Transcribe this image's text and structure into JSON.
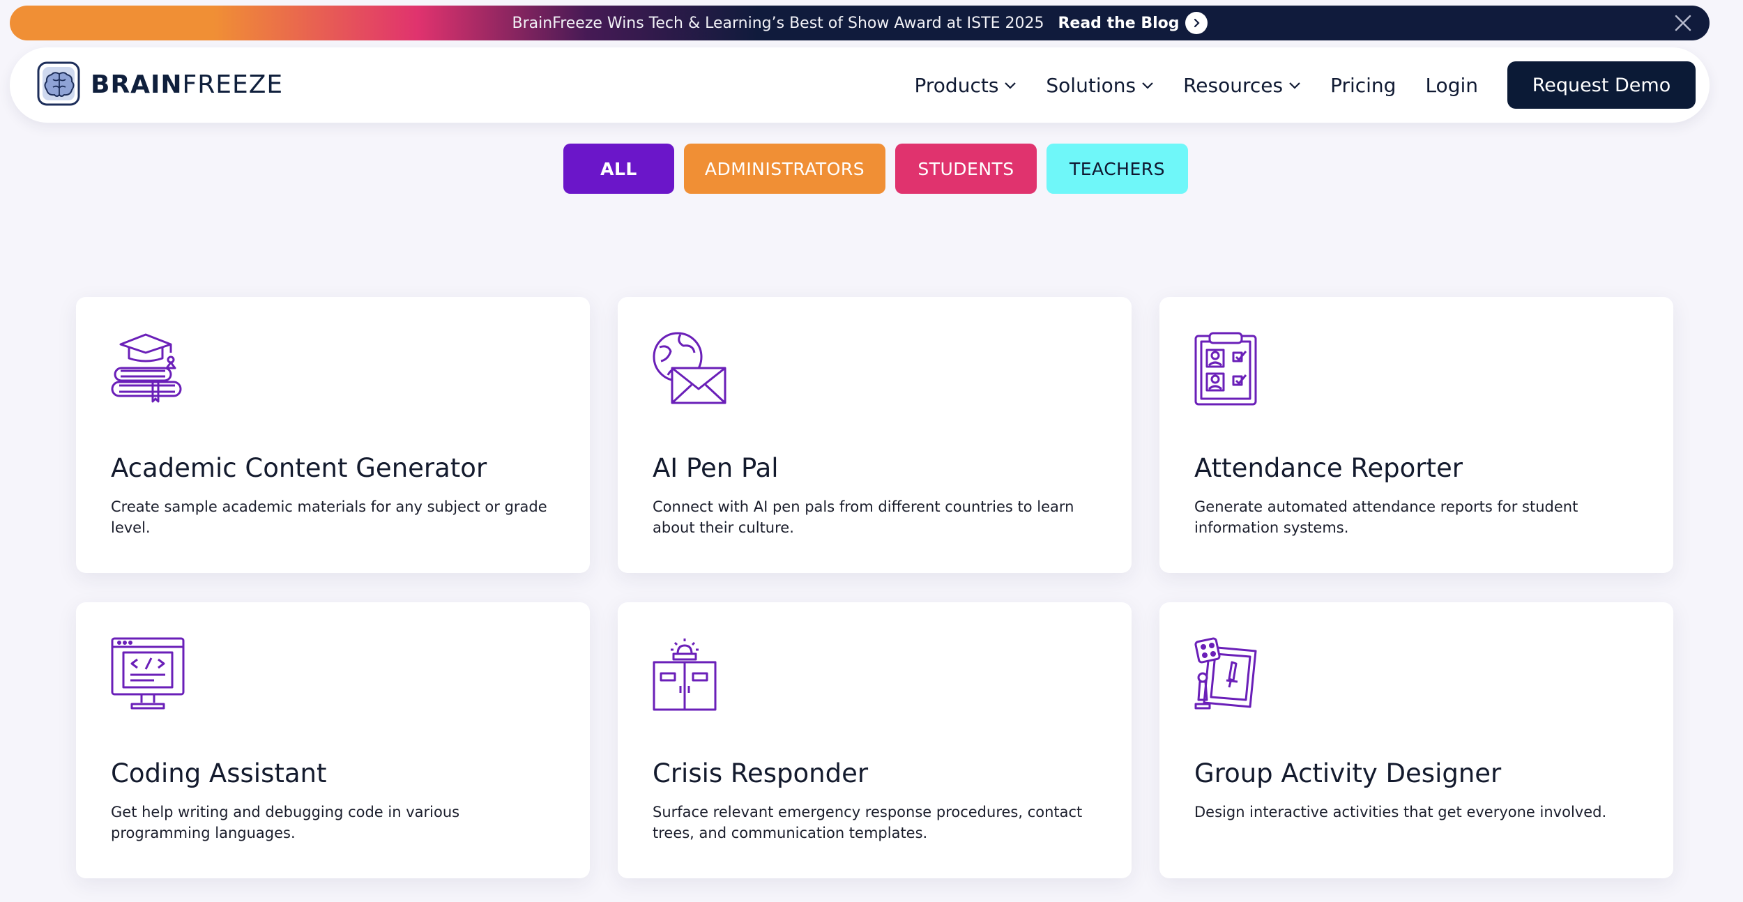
{
  "banner": {
    "text": "BrainFreeze Wins Tech & Learning’s Best of Show Award at ISTE 2025",
    "link_label": "Read the Blog",
    "arrow_icon": "chevron-right-icon",
    "close_icon": "close-icon"
  },
  "header": {
    "logo_bold": "BRAIN",
    "logo_light": "FREEZE",
    "nav": [
      {
        "label": "Products",
        "has_dropdown": true
      },
      {
        "label": "Solutions",
        "has_dropdown": true
      },
      {
        "label": "Resources",
        "has_dropdown": true
      },
      {
        "label": "Pricing",
        "has_dropdown": false
      },
      {
        "label": "Login",
        "has_dropdown": false
      }
    ],
    "cta_label": "Request Demo"
  },
  "filters": [
    {
      "label": "ALL",
      "color": "#6b16c9",
      "selected": true
    },
    {
      "label": "ADMINISTRATORS",
      "color": "#f08f35"
    },
    {
      "label": "STUDENTS",
      "color": "#e0336e"
    },
    {
      "label": "TEACHERS",
      "color": "#6ff7f9"
    }
  ],
  "tools": [
    {
      "title": "Academic Content Generator",
      "description": "Create sample academic materials for any subject or grade level.",
      "icon": "graduation-books-icon"
    },
    {
      "title": "AI Pen Pal",
      "description": "Connect with AI pen pals from different countries to learn about their culture.",
      "icon": "globe-envelope-icon"
    },
    {
      "title": "Attendance Reporter",
      "description": "Generate automated attendance reports for student information systems.",
      "icon": "clipboard-checklist-icon"
    },
    {
      "title": "Coding Assistant",
      "description": "Get help writing and debugging code in various programming languages.",
      "icon": "code-monitor-icon"
    },
    {
      "title": "Crisis Responder",
      "description": "Surface relevant emergency response procedures, contact trees, and communication templates.",
      "icon": "alarm-doors-icon"
    },
    {
      "title": "Group Activity Designer",
      "description": "Design interactive activities that get everyone involved.",
      "icon": "game-board-icon"
    }
  ],
  "colors": {
    "accent": "#6b16c9",
    "navy": "#0b1a36",
    "icon_stroke": "#6a1fb8"
  }
}
